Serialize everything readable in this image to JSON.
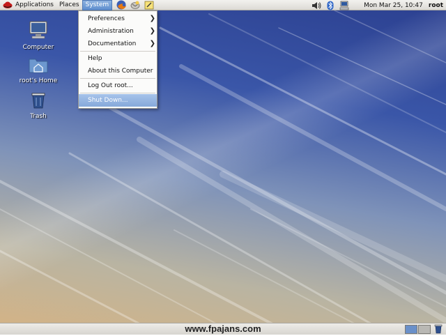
{
  "top_panel": {
    "menus": [
      {
        "label": "Applications"
      },
      {
        "label": "Places"
      },
      {
        "label": "System",
        "active": true
      }
    ],
    "launchers": [
      "firefox-icon",
      "evolution-mail-icon",
      "notes-icon"
    ],
    "tray_icons": [
      "volume-icon",
      "bluetooth-icon",
      "network-icon"
    ],
    "clock": "Mon Mar 25, 10:47",
    "user": "root"
  },
  "desktop_icons": [
    {
      "label": "Computer",
      "icon": "computer-icon"
    },
    {
      "label": "root's Home",
      "icon": "home-folder-icon"
    },
    {
      "label": "Trash",
      "icon": "trash-icon"
    }
  ],
  "system_menu": {
    "items": [
      {
        "label": "Preferences",
        "submenu": true
      },
      {
        "label": "Administration",
        "submenu": true
      },
      {
        "label": "Documentation",
        "submenu": true
      },
      {
        "label": "Help"
      },
      {
        "label": "About this Computer"
      },
      {
        "label": "Log Out root..."
      },
      {
        "label": "Shut Down...",
        "highlighted": true
      }
    ]
  },
  "bottom_panel": {
    "watermark": "www.fpajans.com",
    "workspaces": 2,
    "active_workspace": 1
  },
  "colors": {
    "menu_highlight": "#86a9da",
    "desktop_top": "#2b3f8f",
    "desktop_bottom": "#d6b383"
  }
}
